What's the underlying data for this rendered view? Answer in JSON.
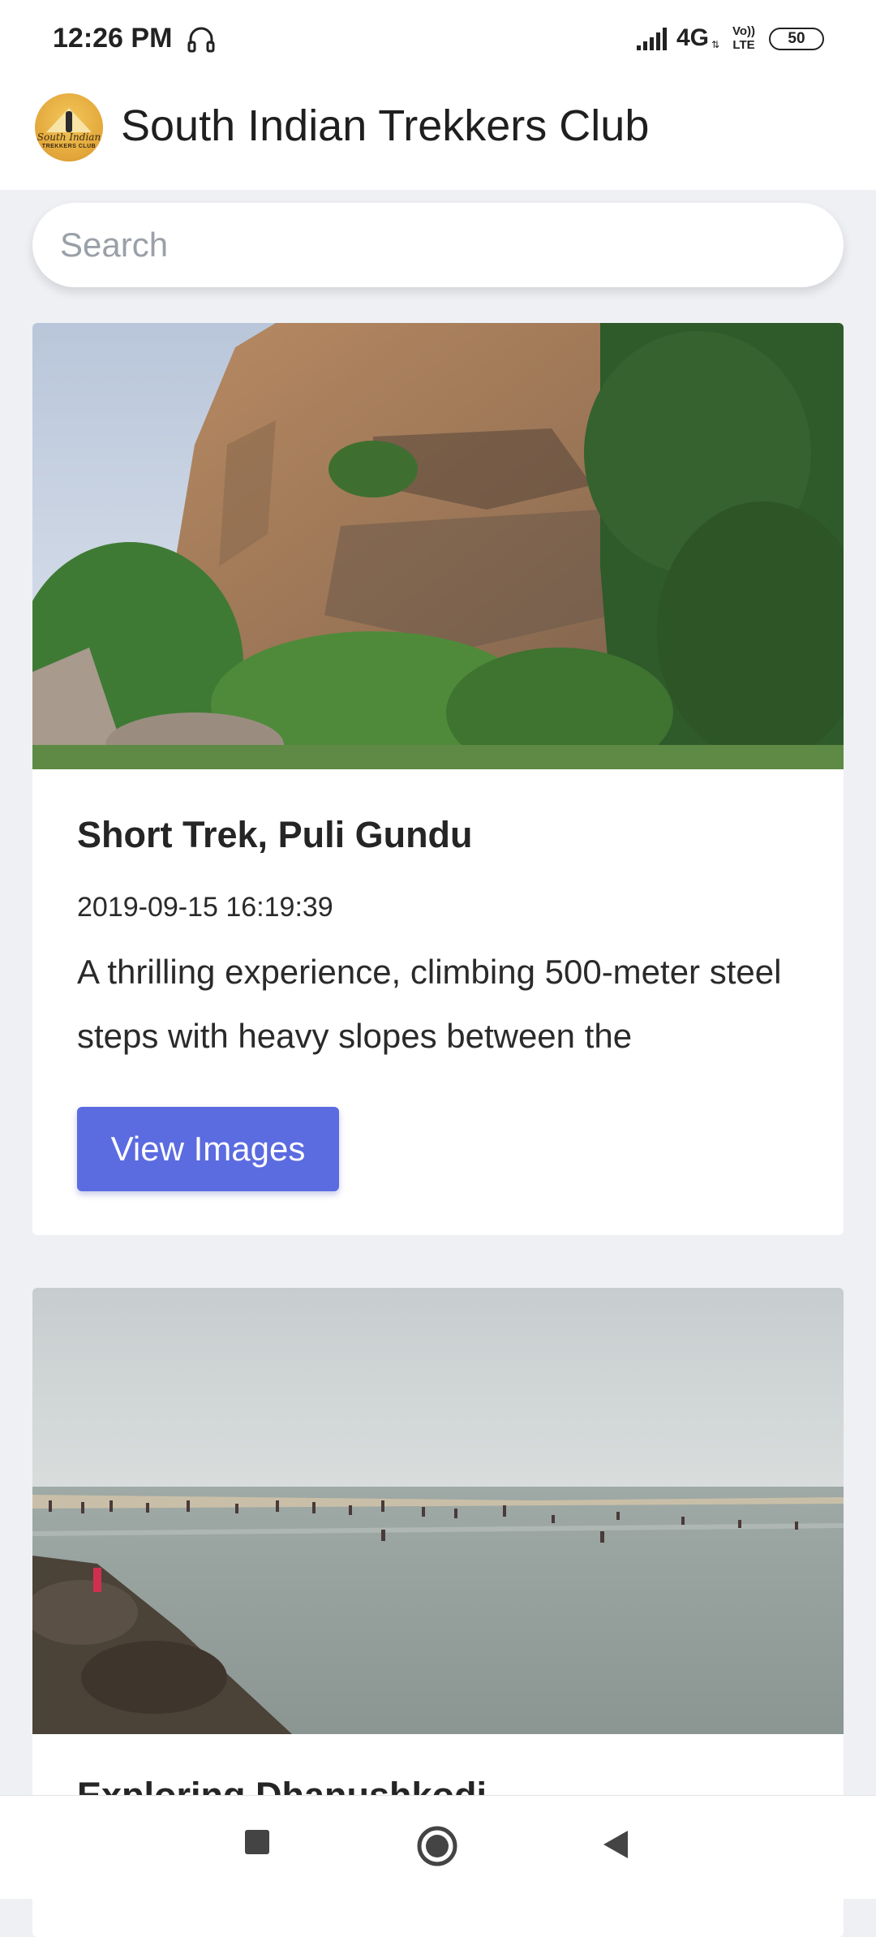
{
  "status_bar": {
    "time": "12:26 PM",
    "network": "4G",
    "volte": "Vo)) LTE",
    "battery": "50"
  },
  "app_bar": {
    "logo_text": "South Indian",
    "logo_subtext": "TREKKERS CLUB",
    "title": "South Indian Trekkers Club"
  },
  "search": {
    "placeholder": "Search",
    "value": ""
  },
  "cards": [
    {
      "title": "Short Trek, Puli Gundu",
      "date": "2019-09-15 16:19:39",
      "description": "A thrilling experience, climbing 500-meter steel steps with heavy slopes between the",
      "button_label": "View Images"
    },
    {
      "title": "Exploring Dhanushkodi"
    }
  ],
  "nav_bar": {
    "recents_icon": "square-icon",
    "home_icon": "circle-icon",
    "back_icon": "triangle-back-icon"
  },
  "colors": {
    "accent": "#5b6be0",
    "background": "#eef0f4"
  }
}
